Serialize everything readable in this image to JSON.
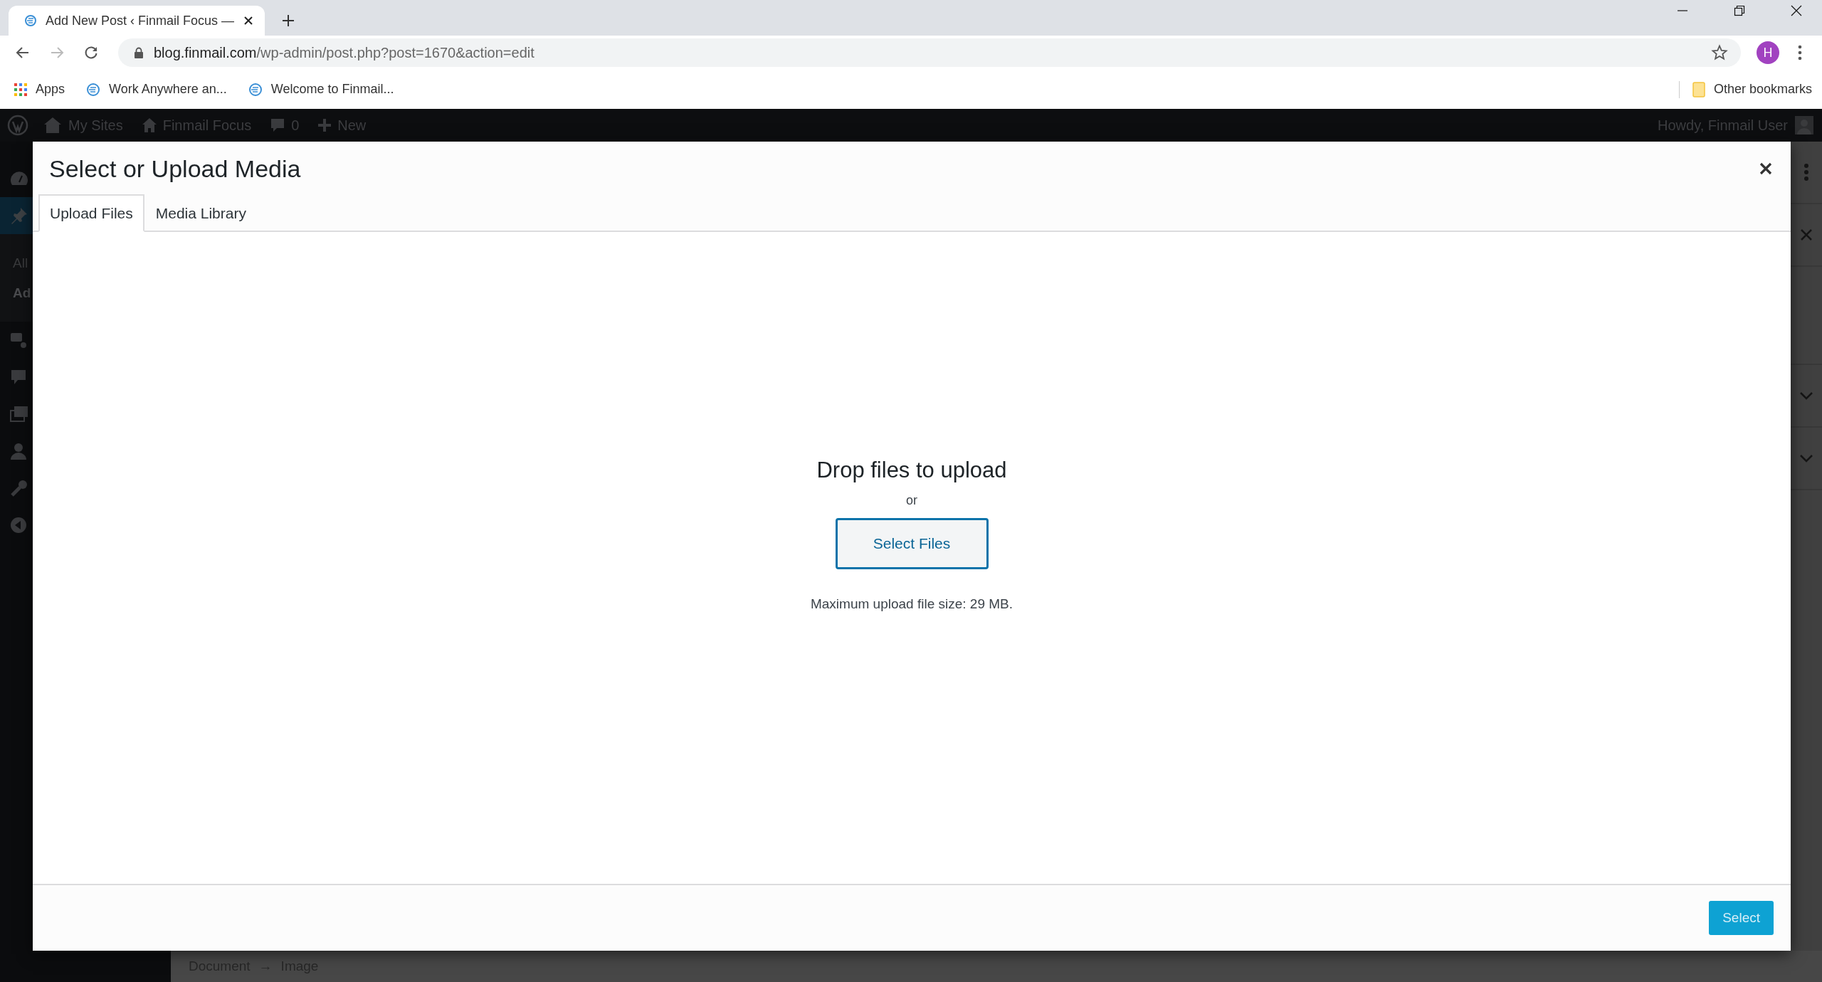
{
  "browser": {
    "tabs": [
      {
        "title": "Add New Post ‹ Finmail Focus —",
        "selected": true
      }
    ],
    "address": {
      "domain": "blog.finmail.com",
      "path": "/wp-admin/post.php?post=1670&action=edit"
    },
    "profile_initial": "H",
    "bookmarks": [
      {
        "label": "Apps",
        "kind": "apps"
      },
      {
        "label": "Work Anywhere an...",
        "kind": "site"
      },
      {
        "label": "Welcome to Finmail...",
        "kind": "site"
      }
    ],
    "other_bookmarks": "Other bookmarks"
  },
  "admin_bar": {
    "items": [
      {
        "label": "My Sites",
        "kind": "sites"
      },
      {
        "label": "Finmail Focus",
        "kind": "home"
      },
      {
        "label": "0",
        "kind": "comments"
      },
      {
        "label": "New",
        "kind": "new"
      }
    ],
    "greeting": "Howdy, Finmail User"
  },
  "sidebar": {
    "menu": [
      {
        "kind": "dashboard",
        "selected": false
      },
      {
        "kind": "posts",
        "selected": true,
        "submenu": [
          {
            "label": "All",
            "selected": false
          },
          {
            "label": "Ad",
            "selected": true
          }
        ]
      },
      {
        "kind": "media",
        "selected": false
      },
      {
        "kind": "comments",
        "selected": false
      },
      {
        "kind": "gallery",
        "selected": false
      },
      {
        "kind": "users",
        "selected": false
      },
      {
        "kind": "tools",
        "selected": false
      },
      {
        "kind": "collapse",
        "selected": false
      }
    ]
  },
  "modal": {
    "title": "Select or Upload Media",
    "tabs": [
      {
        "label": "Upload Files",
        "selected": true
      },
      {
        "label": "Media Library",
        "selected": false
      }
    ],
    "drop_text": "Drop files to upload",
    "or": "or",
    "select_files": "Select Files",
    "max_size": "Maximum upload file size: 29 MB.",
    "select_button": "Select"
  },
  "breadcrumb": {
    "items": [
      "Document",
      "Image"
    ],
    "separator": "→"
  }
}
